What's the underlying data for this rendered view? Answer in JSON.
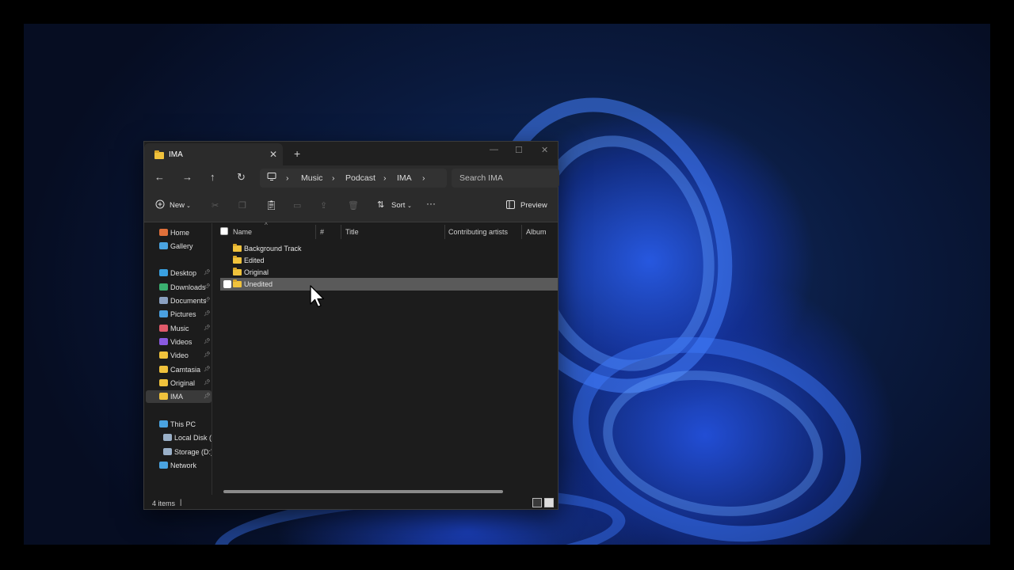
{
  "window": {
    "tab_title": "IMA",
    "tab_close": "✕",
    "new_tab": "+",
    "minimize": "—",
    "maximize": "☐",
    "close": "✕"
  },
  "nav": {
    "back": "←",
    "forward": "→",
    "up": "↑",
    "refresh": "↻",
    "breadcrumb": [
      "Music",
      "Podcast",
      "IMA"
    ],
    "search_placeholder": "Search IMA"
  },
  "commands": {
    "new_label": "New",
    "sort_label": "Sort",
    "more": "···",
    "preview_label": "Preview"
  },
  "sidebar": {
    "items": [
      {
        "label": "Home",
        "icon": "home-icon",
        "color": "#e0703a"
      },
      {
        "label": "Gallery",
        "icon": "gallery-icon",
        "color": "#4aa3e0"
      },
      {
        "label": "Desktop",
        "icon": "desktop-icon",
        "color": "#3aa0e0"
      },
      {
        "label": "Downloads",
        "icon": "download-icon",
        "color": "#3ab070"
      },
      {
        "label": "Documents",
        "icon": "documents-icon",
        "color": "#8aa0c0"
      },
      {
        "label": "Pictures",
        "icon": "pictures-icon",
        "color": "#4aa0e0"
      },
      {
        "label": "Music",
        "icon": "music-icon",
        "color": "#e05a6a"
      },
      {
        "label": "Videos",
        "icon": "videos-icon",
        "color": "#8a5ae0"
      },
      {
        "label": "Video",
        "icon": "folder-icon",
        "color": "#f0c23c"
      },
      {
        "label": "Camtasia",
        "icon": "folder-icon",
        "color": "#f0c23c"
      },
      {
        "label": "Original",
        "icon": "folder-icon",
        "color": "#f0c23c"
      },
      {
        "label": "IMA",
        "icon": "folder-icon",
        "color": "#f0c23c"
      },
      {
        "label": "This PC",
        "icon": "pc-icon",
        "color": "#4aa3e0"
      },
      {
        "label": "Local Disk (C:)",
        "icon": "disk-icon",
        "color": "#9ab0c8"
      },
      {
        "label": "Storage (D:)",
        "icon": "disk-icon",
        "color": "#9ab0c8"
      },
      {
        "label": "Network",
        "icon": "network-icon",
        "color": "#4aa3e0"
      }
    ]
  },
  "columns": [
    "Name",
    "#",
    "Title",
    "Contributing artists",
    "Album"
  ],
  "files": [
    "Background Track",
    "Edited",
    "Original",
    "Unedited"
  ],
  "status": {
    "item_count": "4 items"
  }
}
